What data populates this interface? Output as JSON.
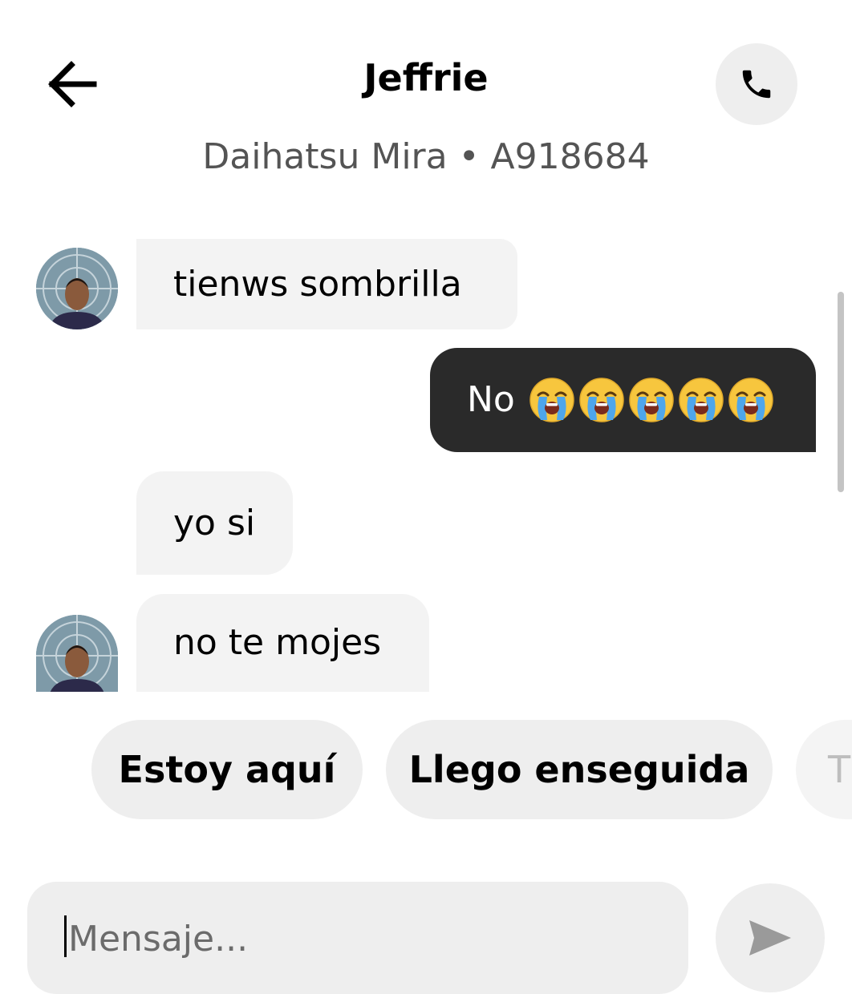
{
  "header": {
    "title": "Jeffrie",
    "subtitle": "Daihatsu Mira • A918684"
  },
  "icons": {
    "back": "arrow-left-icon",
    "call": "phone-icon",
    "send": "send-icon",
    "emoji": "loudly-crying-face"
  },
  "messages": [
    {
      "from": "driver",
      "text": "tienws sombrilla"
    },
    {
      "from": "me",
      "text": "No",
      "emoji_count": 5
    },
    {
      "from": "driver",
      "text": "yo si"
    },
    {
      "from": "driver",
      "text": "no te mojes"
    }
  ],
  "quick_replies": [
    "Estoy aquí",
    "Llego enseguida",
    "T"
  ],
  "input": {
    "placeholder": "Mensaje..."
  },
  "colors": {
    "outgoing_bubble": "#2a2a2a",
    "incoming_bubble": "#f3f3f3",
    "button_bg": "#eeeeee"
  }
}
